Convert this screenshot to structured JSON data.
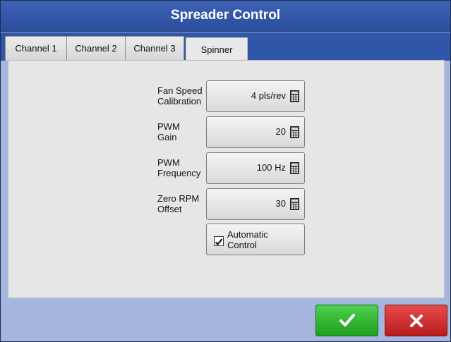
{
  "window": {
    "title": "Spreader Control"
  },
  "tabs": [
    {
      "label": "Channel 1"
    },
    {
      "label": "Channel 2"
    },
    {
      "label": "Channel 3"
    },
    {
      "label": "Spinner",
      "active": true
    }
  ],
  "settings": {
    "fan_speed_calibration": {
      "label_line1": "Fan Speed",
      "label_line2": "Calibration",
      "value": "4 pls/rev",
      "icon": "calculator-icon"
    },
    "pwm_gain": {
      "label_line1": "PWM",
      "label_line2": "Gain",
      "value": "20",
      "icon": "calculator-icon"
    },
    "pwm_frequency": {
      "label_line1": "PWM",
      "label_line2": "Frequency",
      "value": "100 Hz",
      "icon": "calculator-icon"
    },
    "zero_rpm_offset": {
      "label_line1": "Zero RPM",
      "label_line2": "Offset",
      "value": "30",
      "icon": "calculator-icon"
    },
    "automatic_control": {
      "label_line1": "Automatic",
      "label_line2": "Control",
      "checked": true
    }
  },
  "actions": {
    "ok_icon": "checkmark-icon",
    "cancel_icon": "x-icon"
  },
  "colors": {
    "title_bar": "#2f56a8",
    "background": "#a5b6de",
    "ok": "#2fb52f",
    "cancel": "#d02a2a"
  }
}
